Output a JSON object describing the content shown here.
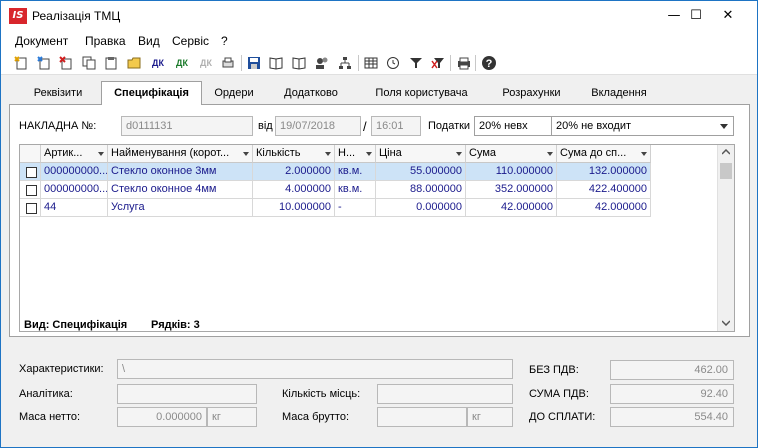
{
  "window": {
    "app_icon": "IS",
    "title": "Реалізація ТМЦ",
    "controls": {
      "minimize": "—",
      "maximize": "☐",
      "close": "✕"
    }
  },
  "menu": [
    "Документ",
    "Правка",
    "Вид",
    "Сервіс",
    "?"
  ],
  "toolbar": {
    "icons": [
      "new-doc-icon",
      "new-copy-icon",
      "delete-icon",
      "copy-icon",
      "paste-icon",
      "folder-icon",
      "dk-icon",
      "dk-green-icon",
      "dk-disabled-icon",
      "print-preview-icon",
      "save-icon",
      "book-icon",
      "book-open-icon",
      "users-icon",
      "tree-icon",
      "table-icon",
      "clock-icon",
      "filter-icon",
      "clear-filter-icon",
      "printer-icon",
      "help-icon"
    ],
    "dk_label": "ДК"
  },
  "tabs": [
    "Реквізити",
    "Специфікація",
    "Ордери",
    "Додатково",
    "Поля користувача",
    "Розрахунки",
    "Вкладення"
  ],
  "active_tab": "Специфікація",
  "header": {
    "invoice_label": "НАКЛАДНА №:",
    "invoice_number": "d0111131",
    "date_label": "від",
    "date": "19/07/2018",
    "slash": "/",
    "time": "16:01",
    "taxes_label": "Податки",
    "tax_value": "20% невх",
    "tax_option": "20% не входит"
  },
  "grid": {
    "columns": [
      "Артик...",
      "Найменування (корот...",
      "Кількість",
      "Н...",
      "Ціна",
      "Сума",
      "Сума до сп..."
    ],
    "rows": [
      {
        "article": "000000000...",
        "name": "Стекло оконное 3мм",
        "qty": "2.000000",
        "unit": "кв.м.",
        "price": "55.000000",
        "sum": "110.000000",
        "to_pay": "132.000000"
      },
      {
        "article": "000000000...",
        "name": "Стекло оконное 4мм",
        "qty": "4.000000",
        "unit": "кв.м.",
        "price": "88.000000",
        "sum": "352.000000",
        "to_pay": "422.400000"
      },
      {
        "article": "44",
        "name": "Услуга",
        "qty": "10.000000",
        "unit": "-",
        "price": "0.000000",
        "sum": "42.000000",
        "to_pay": "42.000000"
      }
    ],
    "footer_view": "Вид: Специфікація",
    "footer_rows": "Рядків: 3"
  },
  "bottom": {
    "characteristics_label": "Характеристики:",
    "characteristics_value": "\\",
    "analytics_label": "Аналітика:",
    "places_label": "Кількість місць:",
    "net_mass_label": "Маса нетто:",
    "net_mass_value": "0.000000",
    "net_mass_unit": "кг",
    "gross_mass_label": "Маса брутто:",
    "gross_mass_unit": "кг",
    "no_vat_label": "БЕЗ ПДВ:",
    "no_vat_value": "462.00",
    "vat_label": "СУМА ПДВ:",
    "vat_value": "92.40",
    "to_pay_label": "ДО СПЛАТИ:",
    "to_pay_value": "554.40"
  },
  "colors": {
    "title_border": "#1e74c4",
    "selected_row": "#cde3f7",
    "grid_text": "#1a1a8c",
    "app_icon": "#d8262c"
  }
}
